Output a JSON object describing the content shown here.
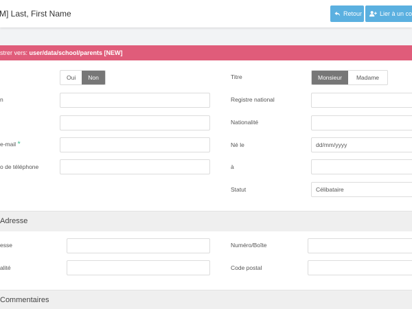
{
  "header": {
    "title": "M] Last, First Name",
    "back_label": "Retour",
    "link_label": "Lier à un co"
  },
  "banner": {
    "prefix": "strer vers: ",
    "path": "user/data/school/parents [NEW]"
  },
  "left_col": {
    "toggle_options": [
      "Oui",
      "Non"
    ],
    "toggle_selected": "Non",
    "name_label": "n",
    "field2_label": "",
    "email_label": "e-mail",
    "phone_label": "o de téléphone"
  },
  "right_col": {
    "titre_label": "Titre",
    "titre_options": [
      "Monsieur",
      "Madame"
    ],
    "titre_selected": "Monsieur",
    "registre_label": "Registre national",
    "nationalite_label": "Nationalité",
    "ne_le_label": "Né le",
    "date_placeholder": "dd/mm/yyyy",
    "a_label": "à",
    "statut_label": "Statut",
    "statut_value": "Célibataire"
  },
  "address": {
    "title": "Adresse",
    "adresse_label": "esse",
    "localite_label": "alité",
    "numero_label": "Numéro/Boîte",
    "code_postal_label": "Code postal"
  },
  "comments": {
    "title": "Commentaires"
  },
  "colors": {
    "banner": "#e05c7a",
    "button": "#5bb0e0",
    "toggle_active": "#777777",
    "required": "#3fbf8f"
  }
}
